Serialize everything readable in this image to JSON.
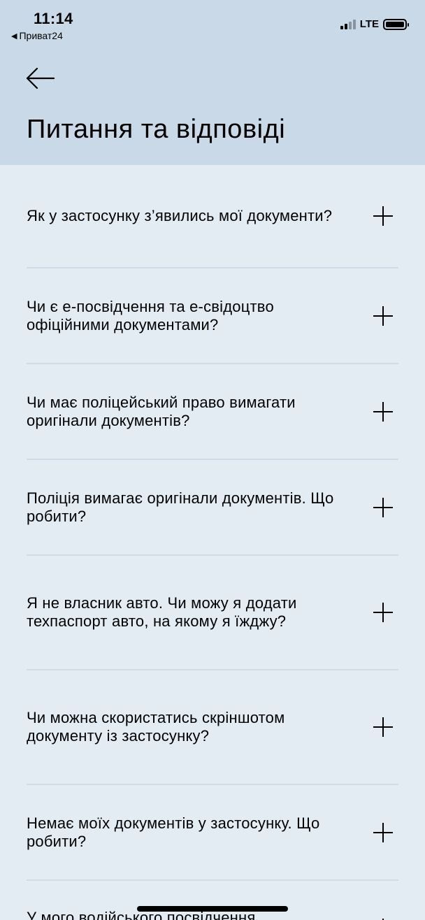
{
  "status_bar": {
    "time": "11:14",
    "back_app": "Приват24",
    "network": "LTE"
  },
  "header": {
    "title": "Питання та відповіді"
  },
  "faq": [
    {
      "question": "Як у застосунку з’явились мої документи?"
    },
    {
      "question": "Чи є е-посвідчення та е-свідоцтво офіційними документами?"
    },
    {
      "question": "Чи має поліцейський право вимагати оригінали документів?"
    },
    {
      "question": "Поліція вимагає оригінали документів. Що робити?"
    },
    {
      "question": "Я не власник авто. Чи можу я додати техпаспорт авто, на якому я їжджу?"
    },
    {
      "question": "Чи можна скористатись скріншотом документу із застосунку?"
    },
    {
      "question": "Немає моїх документів у застосунку. Що робити?"
    },
    {
      "question": "У мого водійського посвідчення"
    }
  ],
  "icons": {
    "back": "arrow-left-icon",
    "expand": "plus-icon"
  },
  "colors": {
    "header_bg": "#c9d9e8",
    "page_bg": "#e3ecf3",
    "divider": "#cfdbe6"
  }
}
